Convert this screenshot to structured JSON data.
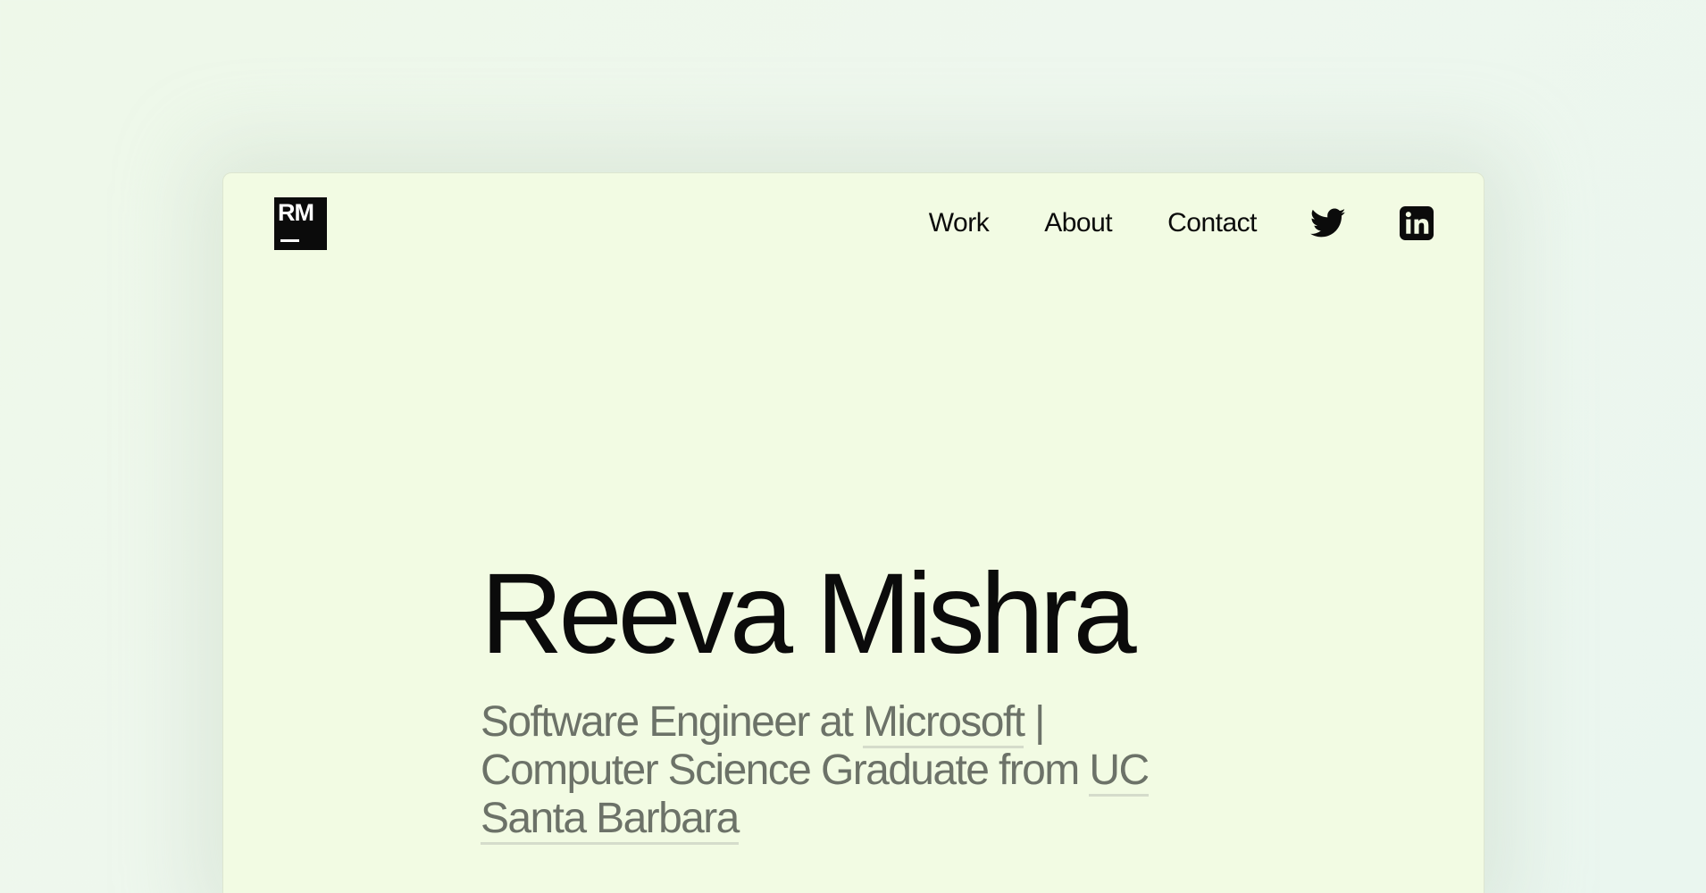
{
  "logo": {
    "text": "RM"
  },
  "nav": {
    "links": [
      {
        "label": "Work"
      },
      {
        "label": "About"
      },
      {
        "label": "Contact"
      }
    ],
    "social": [
      {
        "icon": "twitter-icon"
      },
      {
        "icon": "linkedin-icon"
      }
    ]
  },
  "hero": {
    "name": "Reeva Mishra",
    "tagline": {
      "prefix": "Software Engineer at ",
      "company": "Microsoft",
      "middle": " | Computer Science Graduate from ",
      "school": "UC Santa Barbara"
    }
  },
  "colors": {
    "page_bg": "#eef7ee",
    "card_bg": "#f2fbe3",
    "text": "#0b0b0b",
    "muted": "#6c7268"
  }
}
